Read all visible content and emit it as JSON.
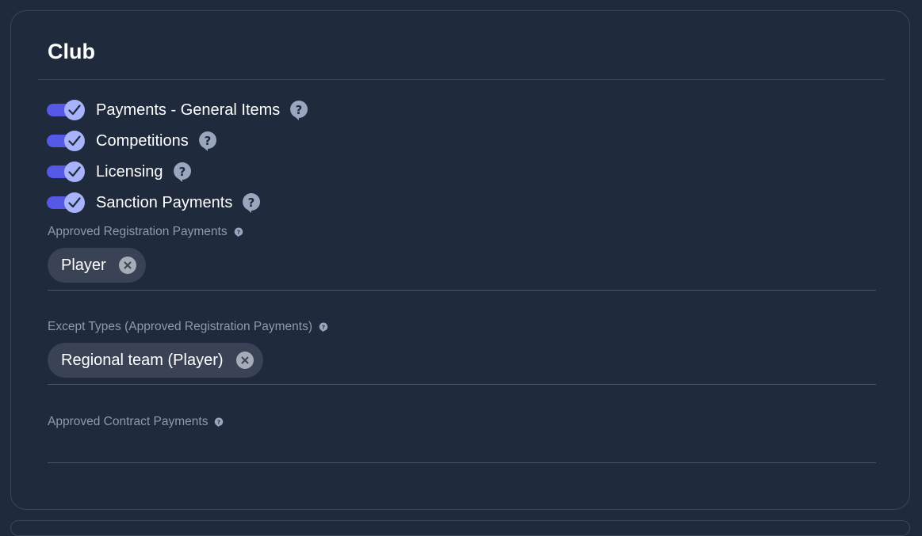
{
  "section": {
    "title": "Club"
  },
  "toggles": [
    {
      "label": "Payments - General Items",
      "checked": true
    },
    {
      "label": "Competitions",
      "checked": true
    },
    {
      "label": "Licensing",
      "checked": true
    },
    {
      "label": "Sanction Payments",
      "checked": true
    }
  ],
  "fields": {
    "approved_registration": {
      "label": "Approved Registration Payments",
      "chips": [
        "Player"
      ]
    },
    "except_types": {
      "label": "Except Types (Approved Registration Payments)",
      "chips": [
        "Regional team (Player)"
      ]
    },
    "approved_contract": {
      "label": "Approved Contract Payments",
      "chips": []
    }
  },
  "colors": {
    "background": "#1f2a3d",
    "toggle_track": "#5658e6",
    "toggle_knob": "#a9b3fb",
    "chip_background": "#3a4355",
    "help_icon": "#9aa6bd"
  },
  "icons": {
    "toggle_check": "check-icon",
    "help": "question-bubble-icon",
    "chip_remove": "close-circle-icon"
  }
}
